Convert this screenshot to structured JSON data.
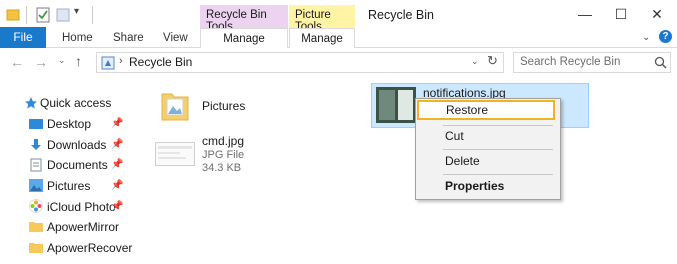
{
  "window": {
    "title": "Recycle Bin"
  },
  "context_tabs": {
    "recycle_bin_tools": "Recycle Bin Tools",
    "picture_tools": "Picture Tools"
  },
  "ribbon": {
    "tabs": [
      "File",
      "Home",
      "Share",
      "View"
    ],
    "manage_rb": "Manage",
    "manage_pt": "Manage"
  },
  "address": {
    "path": "Recycle Bin",
    "search_placeholder": "Search Recycle Bin"
  },
  "sidebar": {
    "items": [
      {
        "label": "Quick access",
        "icon": "star-icon",
        "pinned": false
      },
      {
        "label": "Desktop",
        "icon": "desktop-icon",
        "pinned": true
      },
      {
        "label": "Downloads",
        "icon": "download-icon",
        "pinned": true
      },
      {
        "label": "Documents",
        "icon": "documents-icon",
        "pinned": true
      },
      {
        "label": "Pictures",
        "icon": "pictures-icon",
        "pinned": true
      },
      {
        "label": "iCloud Photo",
        "icon": "icloud-photo-icon",
        "pinned": true
      },
      {
        "label": "ApowerMirror",
        "icon": "folder-icon",
        "pinned": false
      },
      {
        "label": "ApowerRecover",
        "icon": "folder-icon",
        "pinned": false
      }
    ]
  },
  "files": [
    {
      "name": "Pictures",
      "type": "folder"
    },
    {
      "name": "cmd.jpg",
      "kind": "JPG File",
      "size": "34.3 KB"
    },
    {
      "name": "notifications.jpg"
    }
  ],
  "context_menu": {
    "items": [
      "Restore",
      "Cut",
      "Delete",
      "Properties"
    ]
  },
  "colors": {
    "accent": "#1979ca",
    "highlight": "#f0b323",
    "selection": "#cce8ff"
  }
}
